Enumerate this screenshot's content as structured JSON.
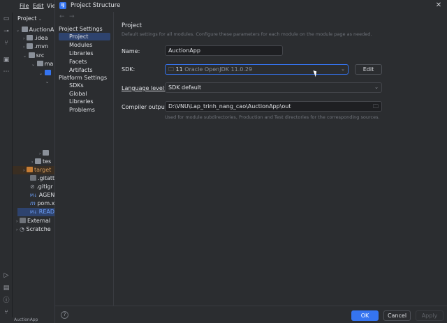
{
  "ide": {
    "menu": [
      "File",
      "Edit",
      "Vie"
    ],
    "project_selector": "Project",
    "tree": [
      {
        "label": "AuctionA",
        "indent": 0
      },
      {
        "label": ".idea",
        "indent": 1
      },
      {
        "label": ".mvn",
        "indent": 1
      },
      {
        "label": "src",
        "indent": 1
      },
      {
        "label": "ma",
        "indent": 2
      },
      {
        "label": "",
        "indent": 3
      },
      {
        "label": "tes",
        "indent": 2
      },
      {
        "label": "target",
        "indent": 1
      },
      {
        "label": ".gitatt",
        "indent": 1
      },
      {
        "label": ".gitigr",
        "indent": 1
      },
      {
        "label": "AGEN",
        "indent": 1
      },
      {
        "label": "pom.x",
        "indent": 1
      },
      {
        "label": "READ",
        "indent": 1
      },
      {
        "label": "External",
        "indent": 0
      },
      {
        "label": "Scratche",
        "indent": 0
      }
    ],
    "status_bar": "AuctionApp"
  },
  "dialog": {
    "title": "Project Structure",
    "nav": {
      "project_settings_header": "Project Settings",
      "project_settings": [
        "Project",
        "Modules",
        "Libraries",
        "Facets",
        "Artifacts"
      ],
      "platform_settings_header": "Platform Settings",
      "platform_settings": [
        "SDKs",
        "Global Libraries"
      ],
      "problems": "Problems"
    },
    "content": {
      "section_title": "Project",
      "section_desc": "Default settings for all modules. Configure these parameters for each module on the module page as needed.",
      "name_label": "Name:",
      "name_value": "AuctionApp",
      "sdk_label": "SDK:",
      "sdk_version": "11",
      "sdk_name": "Oracle OpenJDK 11.0.29",
      "sdk_edit": "Edit",
      "language_level_label": "Language level:",
      "language_level_value": "SDK default",
      "compiler_output_label": "Compiler output:",
      "compiler_output_value": "D:\\VNU\\Lap_trinh_nang_cao\\AuctionApp\\out",
      "compiler_output_hint": "Used for module subdirectories, Production and Test directories for the corresponding sources."
    },
    "footer": {
      "help": "?",
      "ok": "OK",
      "cancel": "Cancel",
      "apply": "Apply"
    }
  },
  "colors": {
    "accent": "#3574f0",
    "background": "#2b2d30",
    "selection": "#2e436e"
  }
}
